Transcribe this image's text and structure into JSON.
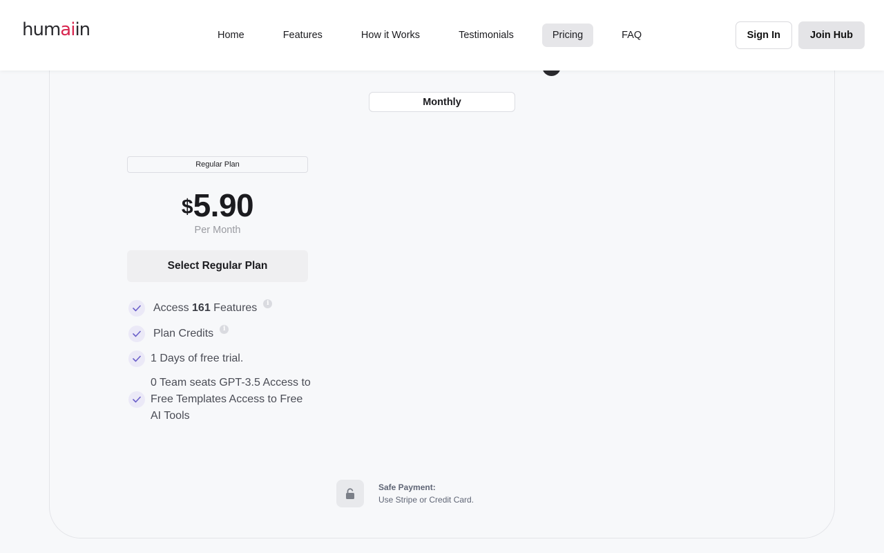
{
  "header": {
    "logo": {
      "part1": "hum",
      "part2": "ai",
      "part3": "in",
      "accent_color": "#d8264f"
    },
    "nav": [
      {
        "label": "Home"
      },
      {
        "label": "Features"
      },
      {
        "label": "How it Works"
      },
      {
        "label": "Testimonials"
      },
      {
        "label": "Pricing",
        "active": true
      },
      {
        "label": "FAQ"
      }
    ],
    "sign_in": "Sign In",
    "join": "Join Hub"
  },
  "pricing": {
    "billing_toggle": "Monthly",
    "plan": {
      "badge": "Regular Plan",
      "currency": "$",
      "price": "5.90",
      "period": "Per Month",
      "cta": "Select Regular Plan",
      "features": [
        {
          "prefix": "Access ",
          "bold": "161",
          "suffix": " Features",
          "info": "i"
        },
        {
          "text": "Plan Credits",
          "info": "i"
        },
        {
          "text": "1 Days of free trial."
        },
        {
          "text": "0 Team seats GPT-3.5 Access to Free Templates Access to Free AI Tools"
        }
      ]
    },
    "safe_payment": {
      "title": "Safe Payment:",
      "subtitle": "Use Stripe or Credit Card."
    }
  },
  "icons": {
    "check": "check-icon",
    "info": "info-icon",
    "lock": "lock-icon"
  },
  "colors": {
    "check_bg": "#ebe9f7",
    "check_stroke": "#6a5fc9",
    "active_nav_bg": "#e6e6e9"
  }
}
